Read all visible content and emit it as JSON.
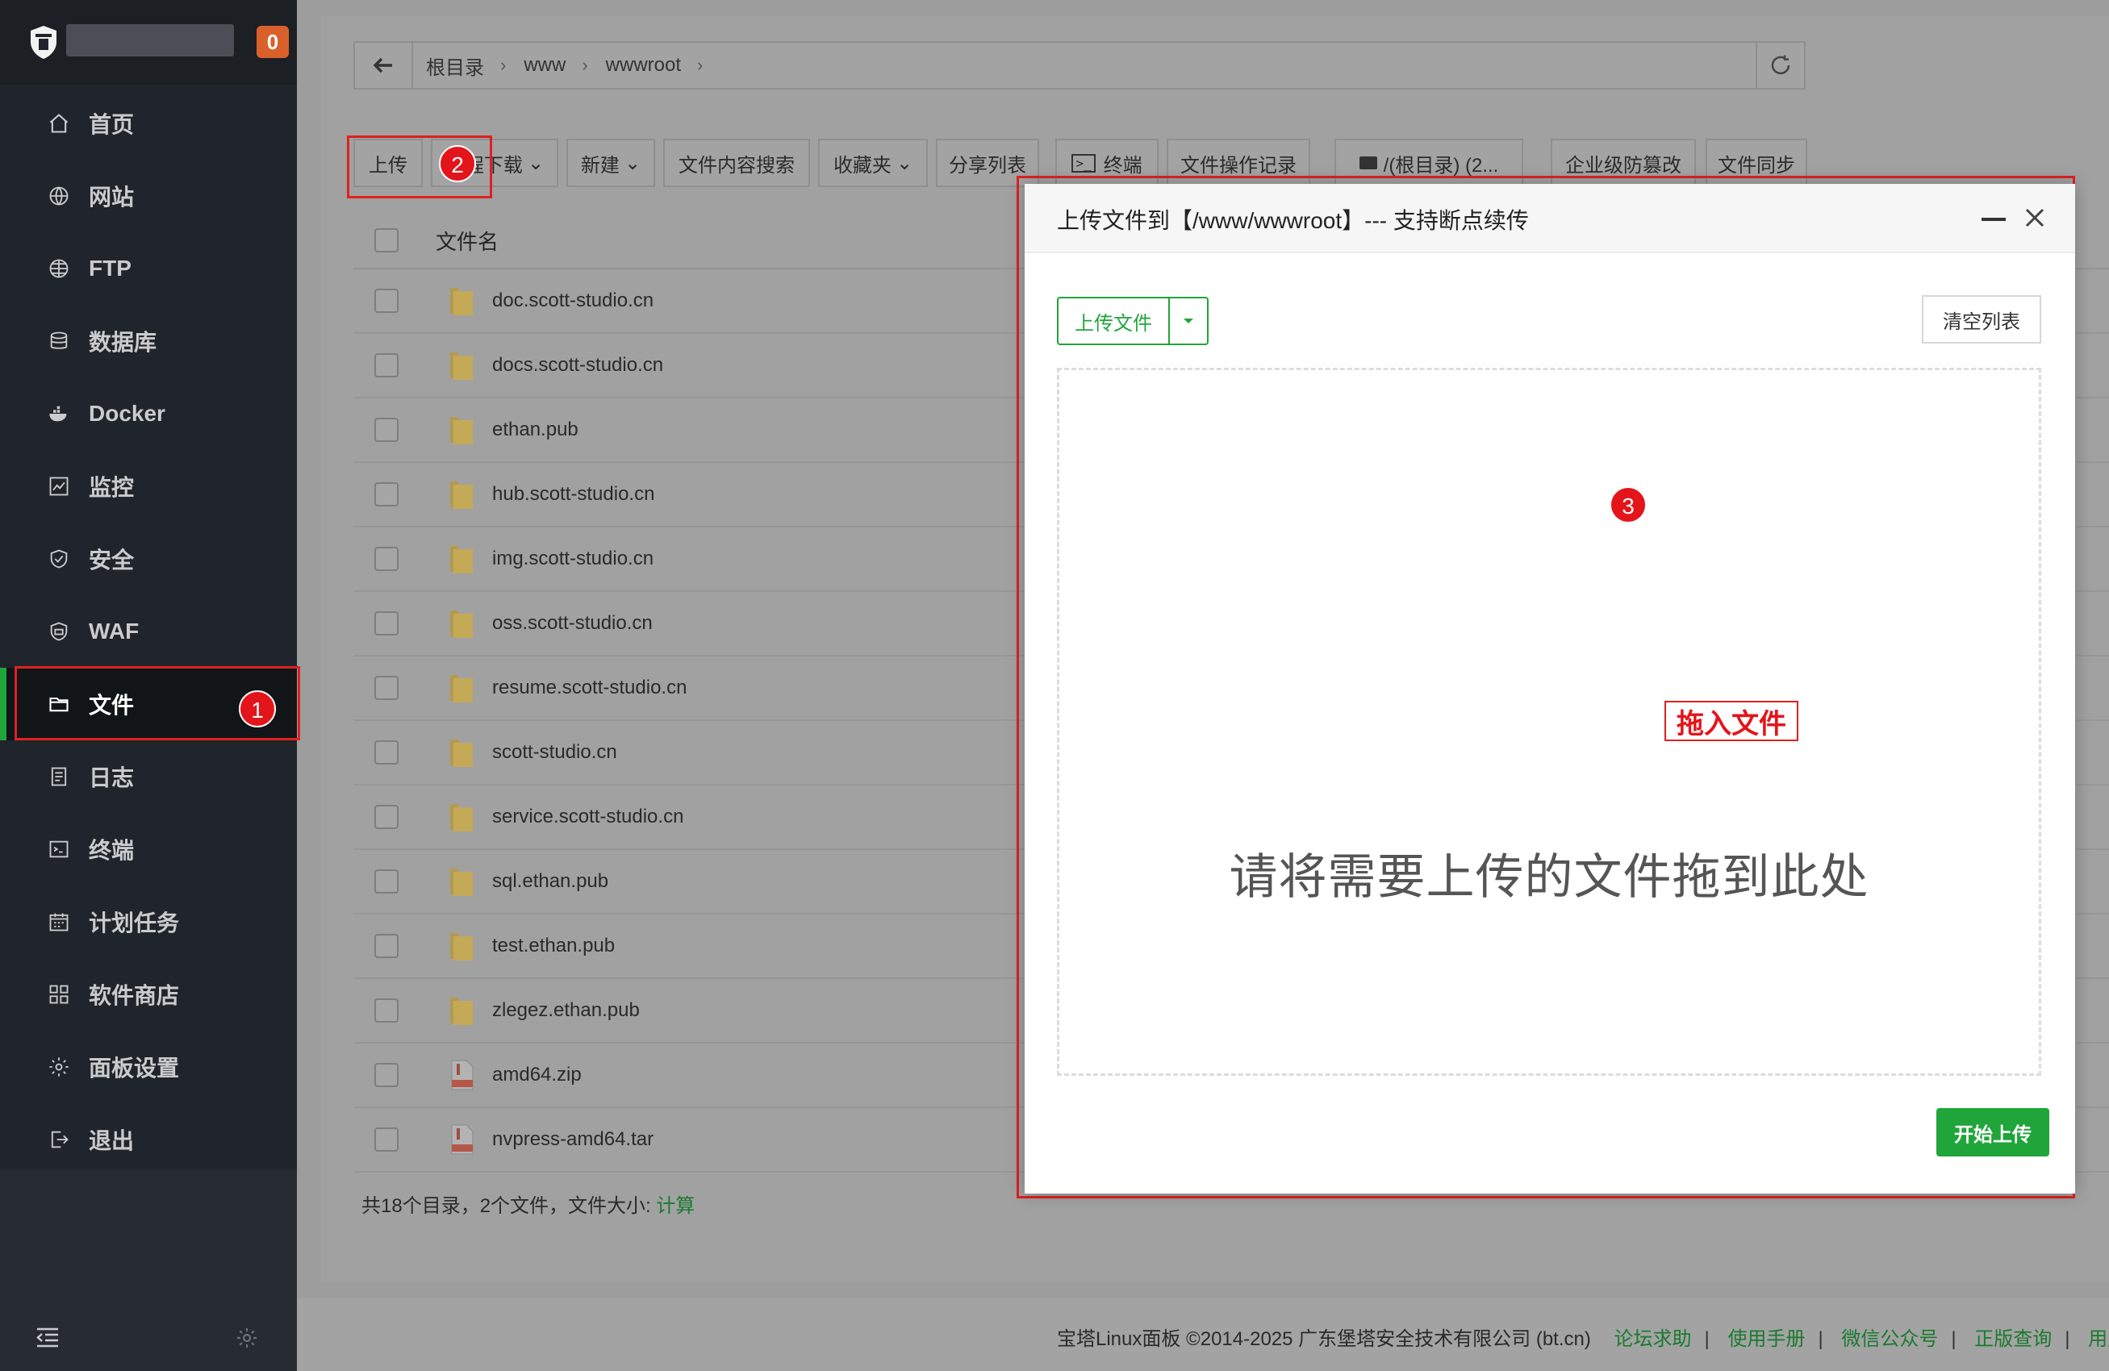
{
  "brand": {
    "badge": "0"
  },
  "sidebar": {
    "items": [
      {
        "label": "首页",
        "icon": "home-icon"
      },
      {
        "label": "网站",
        "icon": "globe-icon"
      },
      {
        "label": "FTP",
        "icon": "ftp-globe-icon"
      },
      {
        "label": "数据库",
        "icon": "database-icon"
      },
      {
        "label": "Docker",
        "icon": "docker-icon"
      },
      {
        "label": "监控",
        "icon": "monitor-chart-icon"
      },
      {
        "label": "安全",
        "icon": "shield-icon"
      },
      {
        "label": "WAF",
        "icon": "waf-shield-icon"
      },
      {
        "label": "文件",
        "icon": "folder-icon",
        "active": true
      },
      {
        "label": "日志",
        "icon": "log-icon"
      },
      {
        "label": "终端",
        "icon": "terminal-icon"
      },
      {
        "label": "计划任务",
        "icon": "calendar-icon"
      },
      {
        "label": "软件商店",
        "icon": "apps-grid-icon"
      },
      {
        "label": "面板设置",
        "icon": "gear-icon"
      },
      {
        "label": "退出",
        "icon": "logout-icon"
      }
    ]
  },
  "address": {
    "crumbs": [
      "根目录",
      "www",
      "wwwroot"
    ]
  },
  "toolbar": {
    "upload": "上传",
    "download": "远程下载",
    "new": "新建",
    "content_search": "文件内容搜索",
    "favorites": "收藏夹",
    "share_list": "分享列表",
    "terminal": "终端",
    "op_log": "文件操作记录",
    "disk": "/(根目录) (2...",
    "tamper": "企业级防篡改",
    "sync": "文件同步"
  },
  "table": {
    "header_name": "文件名",
    "rows": [
      {
        "name": "doc.scott-studio.cn",
        "type": "folder"
      },
      {
        "name": "docs.scott-studio.cn",
        "type": "folder"
      },
      {
        "name": "ethan.pub",
        "type": "folder"
      },
      {
        "name": "hub.scott-studio.cn",
        "type": "folder"
      },
      {
        "name": "img.scott-studio.cn",
        "type": "folder"
      },
      {
        "name": "oss.scott-studio.cn",
        "type": "folder"
      },
      {
        "name": "resume.scott-studio.cn",
        "type": "folder"
      },
      {
        "name": "scott-studio.cn",
        "type": "folder"
      },
      {
        "name": "service.scott-studio.cn",
        "type": "folder"
      },
      {
        "name": "sql.ethan.pub",
        "type": "folder"
      },
      {
        "name": "test.ethan.pub",
        "type": "folder"
      },
      {
        "name": "zlegez.ethan.pub",
        "type": "folder"
      },
      {
        "name": "amd64.zip",
        "type": "zip"
      },
      {
        "name": "nvpress-amd64.tar",
        "type": "tar"
      }
    ],
    "summary": "共18个目录，2个文件，文件大小: ",
    "summary_link": "计算"
  },
  "modal": {
    "title": "上传文件到【/www/wwwroot】--- 支持断点续传",
    "upload_file": "上传文件",
    "clear_list": "清空列表",
    "drop_hint": "请将需要上传的文件拖到此处",
    "drag_label": "拖入文件",
    "start_upload": "开始上传"
  },
  "annotations": {
    "one": "1",
    "two": "2",
    "three": "3"
  },
  "footer": {
    "copyright": "宝塔Linux面板 ©2014-2025 广东堡塔安全技术有限公司 (bt.cn)",
    "links": [
      "论坛求助",
      "使用手册",
      "微信公众号",
      "正版查询",
      "用户"
    ]
  },
  "colors": {
    "accent": "#20a53a",
    "annotation": "#e4141b",
    "sidebar_bg": "#20252b"
  }
}
